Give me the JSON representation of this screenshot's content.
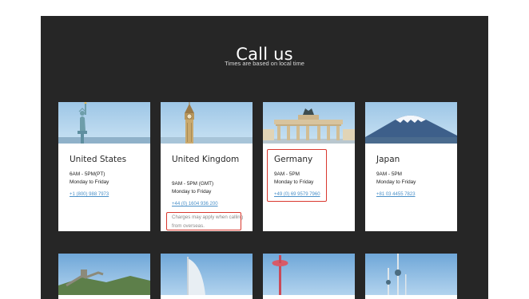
{
  "header": {
    "title": "Call us",
    "subtitle": "Times are based on local time"
  },
  "cards": [
    {
      "country": "United States",
      "hours": "6AM - 5PM(PT)",
      "days": "Monday to Friday",
      "phone": "+1 (800) 988 7973",
      "image": "statue-of-liberty"
    },
    {
      "country": "United Kingdom",
      "hours": "9AM - 5PM (GMT)",
      "days": "Monday to Friday",
      "phone": "+44 (0) 1604 936 200",
      "note": "Charges may apply when calling from overseas.",
      "image": "big-ben"
    },
    {
      "country": "Germany",
      "hours": "9AM - 5PM",
      "days": "Monday to Friday",
      "phone": "+49 (0) 69 9579 7960",
      "image": "brandenburg-gate"
    },
    {
      "country": "Japan",
      "hours": "9AM - 5PM",
      "days": "Monday to Friday",
      "phone": "+81 03 4455 7823",
      "image": "mount-fuji"
    }
  ],
  "second_row_images": [
    "great-wall",
    "burj-al-arab",
    "water-tower",
    "kuwait-towers"
  ],
  "colors": {
    "panel": "#262626",
    "card": "#ffffff",
    "link": "#4a90c8",
    "highlight": "#d9382e"
  }
}
